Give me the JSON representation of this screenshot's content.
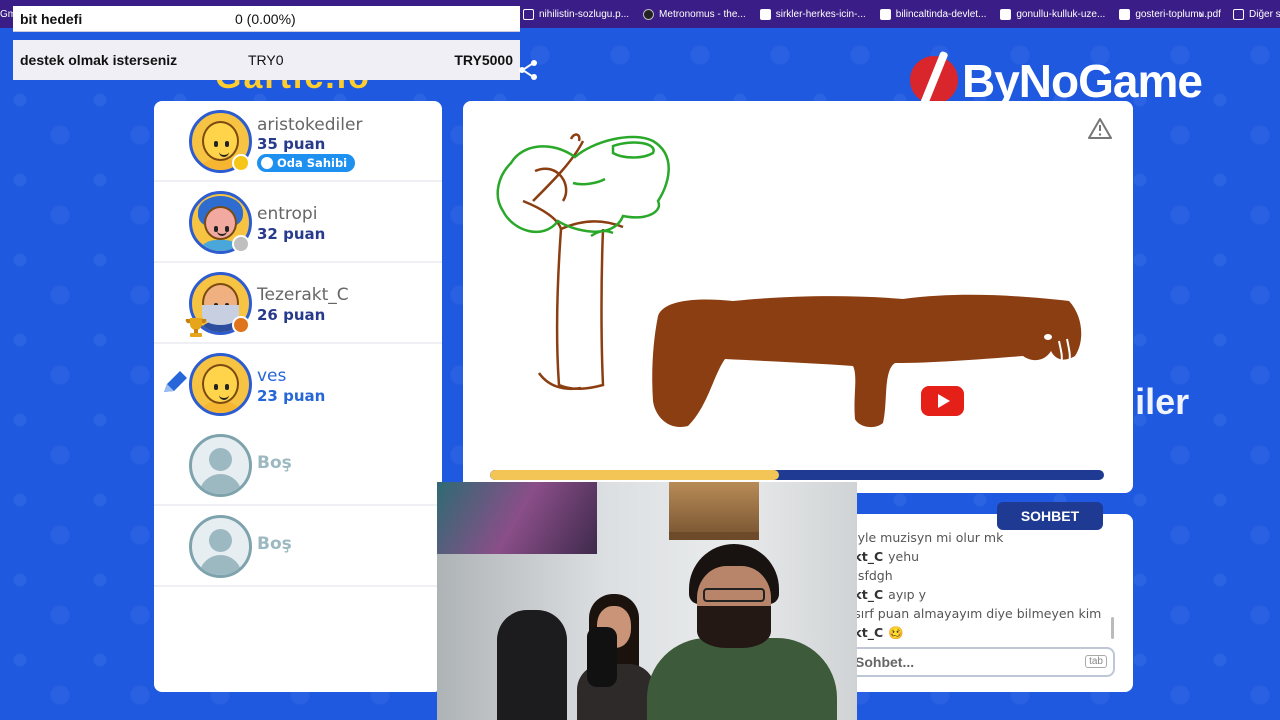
{
  "browser": {
    "bookmarks_first": "Gm",
    "bookmarks": [
      {
        "label": "nihilistin-sozlugu.p...",
        "icon": "page-icon"
      },
      {
        "label": "Metronomus - the...",
        "icon": "metronome-icon"
      },
      {
        "label": "sirkler-herkes-icin-...",
        "icon": "checkbox-icon"
      },
      {
        "label": "bilincaltinda-devlet...",
        "icon": "checkbox-icon"
      },
      {
        "label": "gonullu-kulluk-uze...",
        "icon": "checkbox-icon"
      },
      {
        "label": "gosteri-toplumu.pdf",
        "icon": "checkbox-icon"
      }
    ],
    "bookmarks_more": "›",
    "other_bookmarks": "Diğer s"
  },
  "donation": {
    "goal_label": "bit hedefi",
    "goal_value": "0 (0.00%)",
    "support_label": "destek olmak isterseniz",
    "support_min": "TRY0",
    "support_max": "TRY5000"
  },
  "brand": {
    "name": "ByNoGame"
  },
  "game_logo_text": "Gartic.io",
  "players": [
    {
      "name": "aristokediler",
      "score": "35 puan",
      "badge": "Oda Sahibi",
      "status_color": "#f5c518",
      "avatar": "bald"
    },
    {
      "name": "entropi",
      "score": "32 puan",
      "status_color": "#bfbfbf",
      "avatar": "blue"
    },
    {
      "name": "Tezerakt_C",
      "score": "26 puan",
      "status_color": "#e0741c",
      "avatar": "old",
      "trophy": true
    },
    {
      "name": "ves",
      "score": "23 puan",
      "drawing": true,
      "avatar": "bald"
    },
    {
      "empty_label": "Boş"
    },
    {
      "empty_label": "Boş"
    }
  ],
  "canvas": {
    "timer_progress": 0.47,
    "colors": {
      "green": "#2aa82a",
      "brown": "#8b3e12",
      "bar": "#1f3a93",
      "fill": "#f3c556"
    }
  },
  "overlay": {
    "youtube_channel": "aristokediler"
  },
  "chat": {
    "tab_label": "SOHBET",
    "messages": [
      {
        "user": "",
        "text": "öyle muzisyn mi olur mk"
      },
      {
        "user": "akt_C",
        "text": "yehu"
      },
      {
        "user": "",
        "text": "dsfdgh"
      },
      {
        "user": "akt_C",
        "text": "ayıp y"
      },
      {
        "user": "i",
        "text": "sırf puan almayayım diye bilmeyen kim"
      },
      {
        "user": "akt_C",
        "text": "🥴"
      }
    ],
    "input_placeholder": "Sohbet...",
    "tab_hint": "tab"
  }
}
